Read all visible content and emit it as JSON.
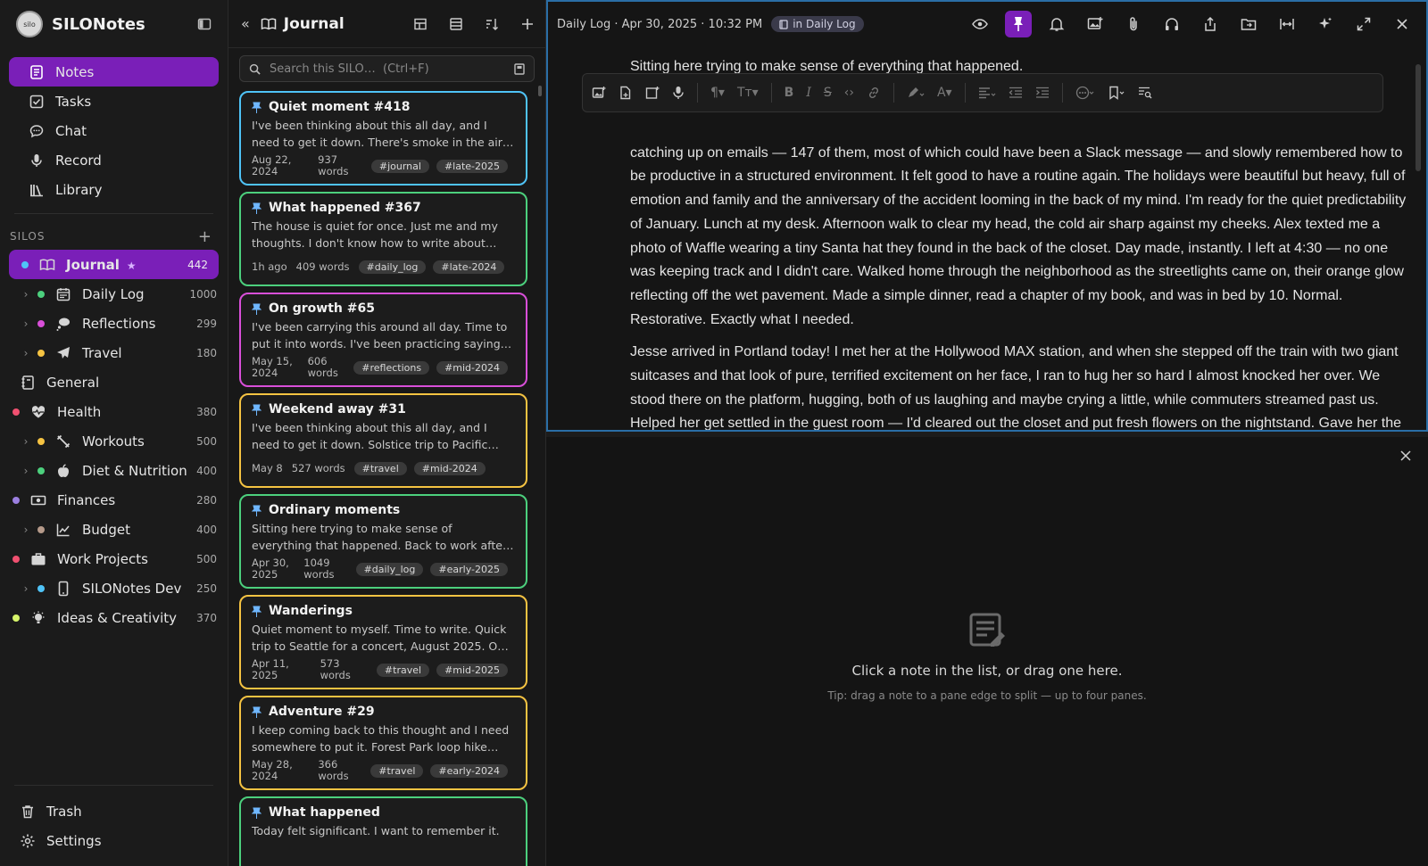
{
  "brand": {
    "name": "SILONotes",
    "logo_text": "silo"
  },
  "nav": [
    {
      "label": "Notes",
      "icon": "notes-icon",
      "active": true
    },
    {
      "label": "Tasks",
      "icon": "tasks-icon"
    },
    {
      "label": "Chat",
      "icon": "chat-icon"
    },
    {
      "label": "Record",
      "icon": "microphone-icon"
    },
    {
      "label": "Library",
      "icon": "library-icon"
    }
  ],
  "silos_header": {
    "label": "SILOS",
    "add": "+"
  },
  "silos": [
    {
      "label": "Journal",
      "count": "442",
      "color": "#4fc3f7",
      "active": true,
      "star": "★"
    },
    {
      "label": "Daily Log",
      "count": "1000",
      "color": "#4cd07d",
      "child": true
    },
    {
      "label": "Reflections",
      "count": "299",
      "color": "#d94fd9",
      "child": true
    },
    {
      "label": "Travel",
      "count": "180",
      "color": "#f5c342",
      "child": true
    },
    {
      "label": "General",
      "count": "",
      "color": ""
    },
    {
      "label": "Health",
      "count": "380",
      "color": "#f05070"
    },
    {
      "label": "Workouts",
      "count": "500",
      "color": "#f5c342",
      "child": true
    },
    {
      "label": "Diet & Nutrition",
      "count": "400",
      "color": "#4cd07d",
      "child": true
    },
    {
      "label": "Finances",
      "count": "280",
      "color": "#9b7fe0"
    },
    {
      "label": "Budget",
      "count": "400",
      "color": "#b59a8a",
      "child": true
    },
    {
      "label": "Work Projects",
      "count": "500",
      "color": "#f05070"
    },
    {
      "label": "SILONotes Dev",
      "count": "250",
      "color": "#4fc3f7",
      "child": true
    },
    {
      "label": "Ideas & Creativity",
      "count": "370",
      "color": "#d7f56b"
    }
  ],
  "bottom_nav": [
    {
      "label": "Trash"
    },
    {
      "label": "Settings"
    }
  ],
  "list": {
    "title": "Journal",
    "collapse": "«",
    "search_placeholder": "Search this SILO…  (Ctrl+F)"
  },
  "cards": [
    {
      "title": "Quiet moment #418",
      "text": "I've been thinking about this all day, and I need to get it down. There's smoke in the air again.…",
      "date": "Aug 22, 2024",
      "words": "937 words",
      "tags": [
        "#journal",
        "#late-2025"
      ],
      "color": "#4fc3f7"
    },
    {
      "title": "What happened #367",
      "text": "The house is quiet for once. Just me and my thoughts. I don't know how to write about toda…",
      "date": "1h ago",
      "words": "409 words",
      "tags": [
        "#daily_log",
        "#late-2024"
      ],
      "color": "#4cd07d"
    },
    {
      "title": "On growth #65",
      "text": "I've been carrying this around all day. Time to put it into words. I've been practicing saying thank…",
      "date": "May 15, 2024",
      "words": "606 words",
      "tags": [
        "#reflections",
        "#mid-2024"
      ],
      "color": "#d94fd9"
    },
    {
      "title": "Weekend away #31",
      "text": "I've been thinking about this all day, and I need to get it down. Solstice trip to Pacific City, June…",
      "date": "May 8",
      "words": "527 words",
      "tags": [
        "#travel",
        "#mid-2024"
      ],
      "color": "#f5c342"
    },
    {
      "title": "Ordinary moments",
      "text": "Sitting here trying to make sense of everything that happened. Back to work after the holiday…",
      "date": "Apr 30, 2025",
      "words": "1049 words",
      "tags": [
        "#daily_log",
        "#early-2025"
      ],
      "color": "#4cd07d"
    },
    {
      "title": "Wanderings",
      "text": "Quiet moment to myself. Time to write. Quick trip to Seattle for a concert, August 2025. One …",
      "date": "Apr 11, 2025",
      "words": "573 words",
      "tags": [
        "#travel",
        "#mid-2025"
      ],
      "color": "#f5c342"
    },
    {
      "title": "Adventure #29",
      "text": "I keep coming back to this thought and I need somewhere to put it. Forest Park loop hike with…",
      "date": "May 28, 2024",
      "words": "366 words",
      "tags": [
        "#travel",
        "#early-2024"
      ],
      "color": "#f5c342"
    },
    {
      "title": "What happened",
      "text": "Today felt significant. I want to remember it.",
      "date": "",
      "words": "",
      "tags": [],
      "color": "#4cd07d"
    }
  ],
  "pane": {
    "crumb": "Daily Log · Apr 30, 2025 · 10:32 PM",
    "badge": "in Daily Log",
    "first_line": "Sitting here trying to make sense of everything that happened.",
    "para1": "catching up on emails — 147 of them, most of which could have been a Slack message — and slowly remembered how to be productive in a structured environment. It felt good to have a routine again. The holidays were beautiful but heavy, full of emotion and family and the anniversary of the accident looming in the back of my mind. I'm ready for the quiet predictability of January. Lunch at my desk. Afternoon walk to clear my head, the cold air sharp against my cheeks. Alex texted me a photo of Waffle wearing a tiny Santa hat they found in the back of the closet. Day made, instantly. I left at 4:30 — no one was keeping track and I didn't care. Walked home through the neighborhood as the streetlights came on, their orange glow reflecting off the wet pavement. Made a simple dinner, read a chapter of my book, and was in bed by 10. Normal. Restorative. Exactly what I needed.",
    "para2": "Jesse arrived in Portland today! I met her at the Hollywood MAX station, and when she stepped off the train with two giant suitcases and that look of pure, terrified excitement on her face, I ran to hug her so hard I almost knocked her over. We stood there on the platform, hugging, both of us laughing and maybe crying a little, while commuters streamed past us. Helped her get settled in the guest room — I'd cleared out the closet and put fresh flowers on the nightstand. Gave her the tour of the neighborhood: the coffee shop where I go on"
  },
  "empty": {
    "message": "Click a note in the list, or drag one here.",
    "tip": "Tip: drag a note to a pane edge to split — up to four panes."
  }
}
